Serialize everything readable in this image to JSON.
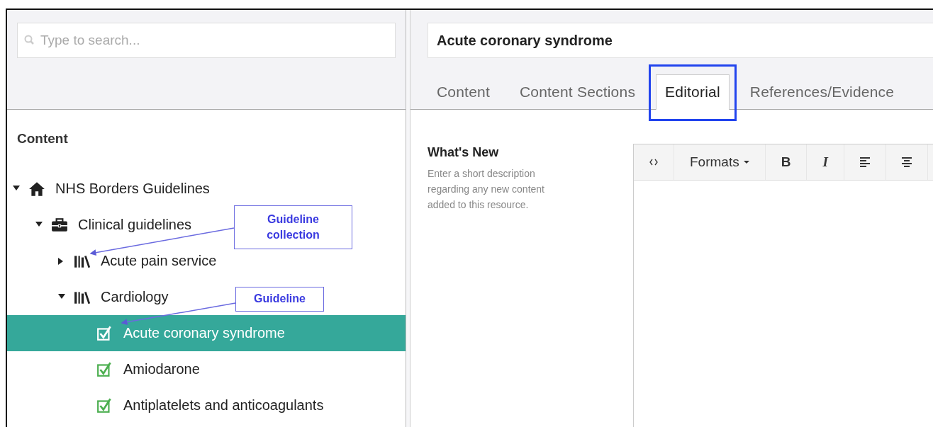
{
  "sidebar": {
    "search": {
      "placeholder": "Type to search..."
    },
    "heading": "Content",
    "tree": [
      {
        "label": "NHS Borders Guidelines",
        "kind": "home",
        "expanded": true,
        "selected": false,
        "children": [
          {
            "label": "Clinical guidelines",
            "kind": "briefcase",
            "expanded": true,
            "selected": false,
            "children": [
              {
                "label": "Acute pain service",
                "kind": "library",
                "expanded": false,
                "selected": false
              },
              {
                "label": "Cardiology",
                "kind": "library",
                "expanded": true,
                "selected": false,
                "children": [
                  {
                    "label": "Acute coronary syndrome",
                    "kind": "guideline",
                    "selected": true
                  },
                  {
                    "label": "Amiodarone",
                    "kind": "guideline",
                    "selected": false
                  },
                  {
                    "label": "Antiplatelets and anticoagulants",
                    "kind": "guideline",
                    "selected": false
                  }
                ]
              }
            ]
          }
        ]
      }
    ]
  },
  "editor": {
    "title": "Acute coronary syndrome",
    "tabs": [
      {
        "label": "Content",
        "selected": false
      },
      {
        "label": "Content Sections",
        "selected": false
      },
      {
        "label": "Editorial",
        "selected": true
      },
      {
        "label": "References/Evidence",
        "selected": false
      }
    ],
    "field": {
      "label": "What's New",
      "description": "Enter a short description regarding any new content added to this resource.",
      "toolbar": [
        {
          "kind": "code"
        },
        {
          "kind": "formats",
          "label": "Formats"
        },
        {
          "kind": "bold",
          "label": "B"
        },
        {
          "kind": "italic",
          "label": "I"
        },
        {
          "kind": "align-left"
        },
        {
          "kind": "align-center"
        }
      ]
    }
  },
  "annotations": [
    {
      "text": "Guideline collection"
    },
    {
      "text": "Guideline"
    }
  ]
}
